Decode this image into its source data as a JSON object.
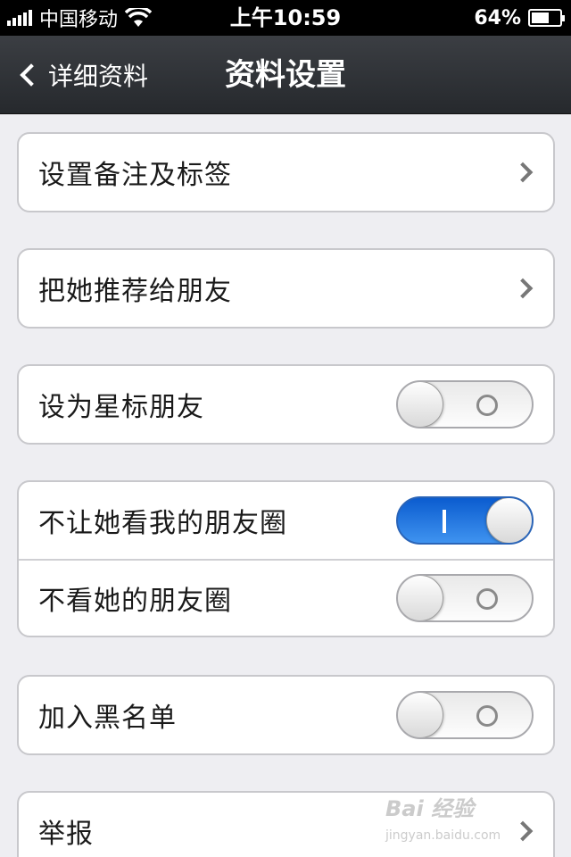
{
  "status_bar": {
    "carrier": "中国移动",
    "time": "上午10:59",
    "battery_text": "64%",
    "battery_level": 0.64
  },
  "nav": {
    "back_label": "详细资料",
    "title": "资料设置"
  },
  "groups": [
    {
      "rows": [
        {
          "label": "设置备注及标签",
          "control": "chevron"
        }
      ]
    },
    {
      "rows": [
        {
          "label": "把她推荐给朋友",
          "control": "chevron"
        }
      ]
    },
    {
      "rows": [
        {
          "label": "设为星标朋友",
          "control": "switch",
          "on": false
        }
      ]
    },
    {
      "rows": [
        {
          "label": "不让她看我的朋友圈",
          "control": "switch",
          "on": true
        },
        {
          "label": "不看她的朋友圈",
          "control": "switch",
          "on": false
        }
      ]
    },
    {
      "rows": [
        {
          "label": "加入黑名单",
          "control": "switch",
          "on": false
        }
      ]
    },
    {
      "rows": [
        {
          "label": "举报",
          "control": "chevron"
        }
      ]
    }
  ],
  "watermark": {
    "brand": "Bai 经验",
    "url": "jingyan.baidu.com"
  }
}
